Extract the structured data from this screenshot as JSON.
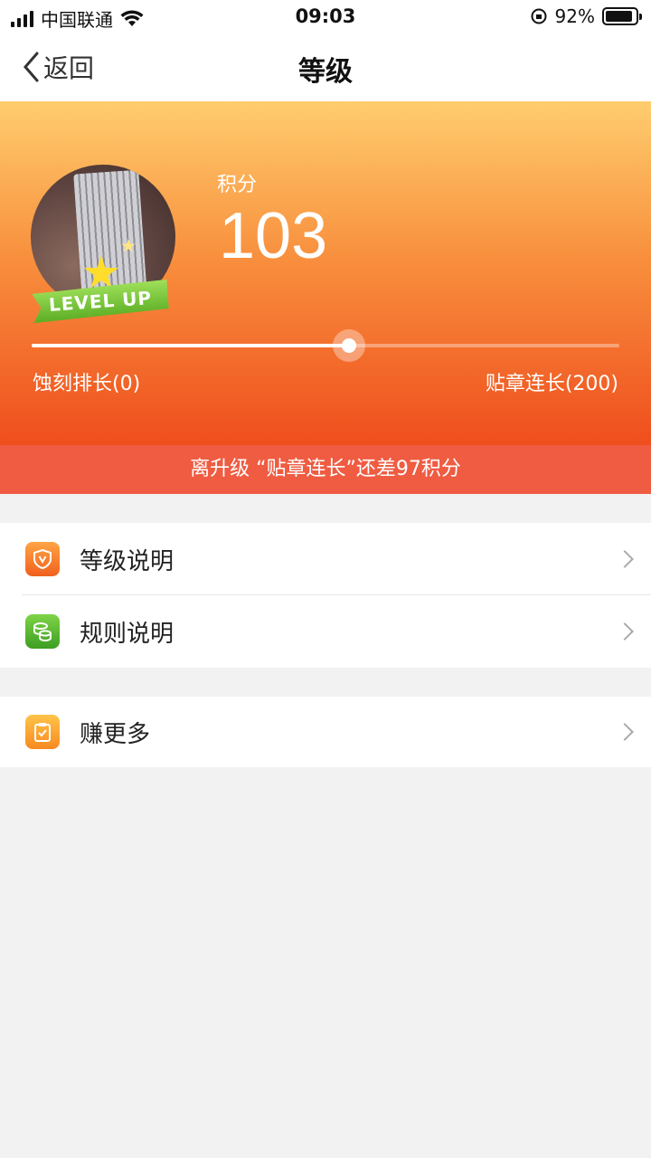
{
  "status_bar": {
    "carrier": "中国联通",
    "time": "09:03",
    "battery_percent": "92%",
    "battery_level": 0.92
  },
  "nav": {
    "back_label": "返回",
    "title": "等级"
  },
  "hero": {
    "badge_text": "LEVEL UP",
    "points_label": "积分",
    "points_value": "103",
    "progress": 0.54,
    "current_level": "蚀刻排长(0)",
    "next_level": "贴章连长(200)"
  },
  "upgrade_notice": "离升级 “贴章连长”还差97积分",
  "menu": {
    "group1": [
      {
        "label": "等级说明",
        "icon": "shield-v-icon"
      },
      {
        "label": "规则说明",
        "icon": "coins-icon"
      }
    ],
    "group2": [
      {
        "label": "赚更多",
        "icon": "clipboard-check-icon"
      }
    ]
  }
}
